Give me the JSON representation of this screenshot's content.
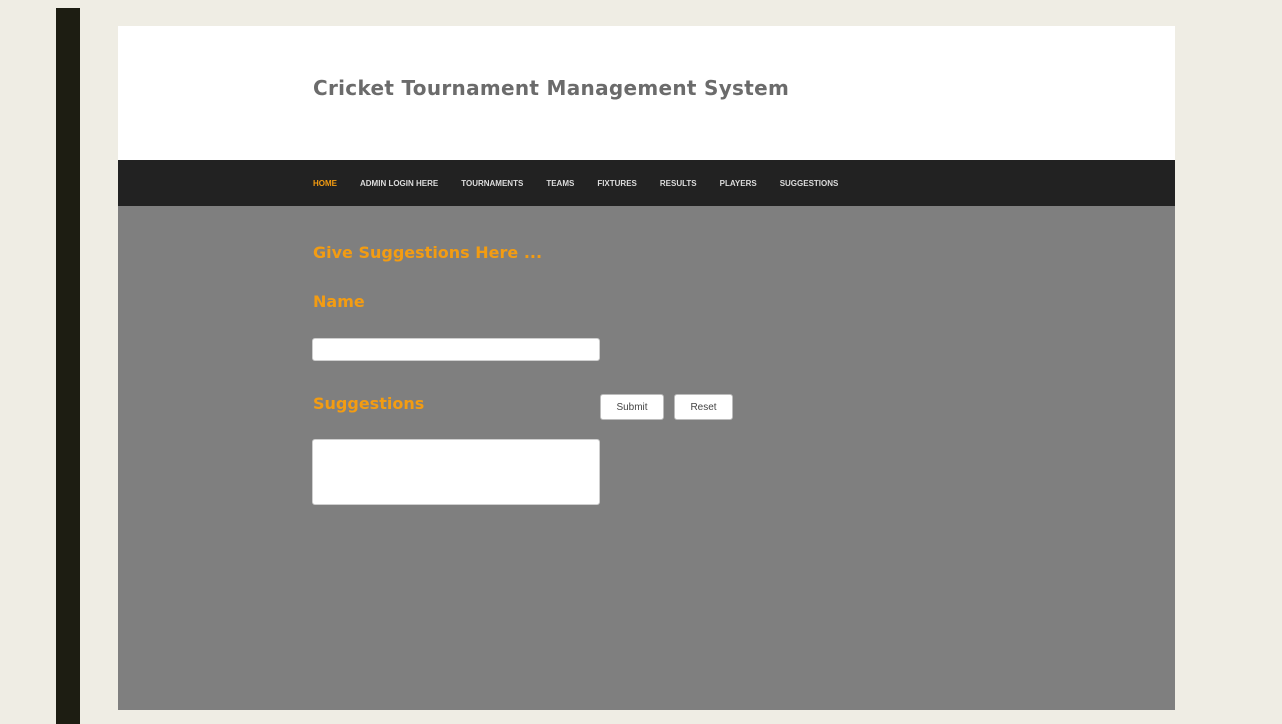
{
  "site": {
    "title": "Cricket Tournament Management System"
  },
  "nav": {
    "items": [
      {
        "label": "HOME",
        "active": true
      },
      {
        "label": "ADMIN LOGIN HERE",
        "active": false
      },
      {
        "label": "TOURNAMENTS",
        "active": false
      },
      {
        "label": "TEAMS",
        "active": false
      },
      {
        "label": "FIXTURES",
        "active": false
      },
      {
        "label": "RESULTS",
        "active": false
      },
      {
        "label": "PLAYERS",
        "active": false
      },
      {
        "label": "SUGGESTIONS",
        "active": false
      }
    ]
  },
  "form": {
    "heading": "Give Suggestions Here ...",
    "name_label": "Name",
    "name_value": "",
    "suggestions_label": "Suggestions",
    "suggestions_value": "",
    "submit_label": "Submit",
    "reset_label": "Reset"
  },
  "colors": {
    "accent": "#f39c12",
    "nav_background": "#222222",
    "content_background": "#7f7f7f",
    "header_background": "#ffffff",
    "page_background": "#efede4",
    "left_bar": "#1d1d12"
  }
}
